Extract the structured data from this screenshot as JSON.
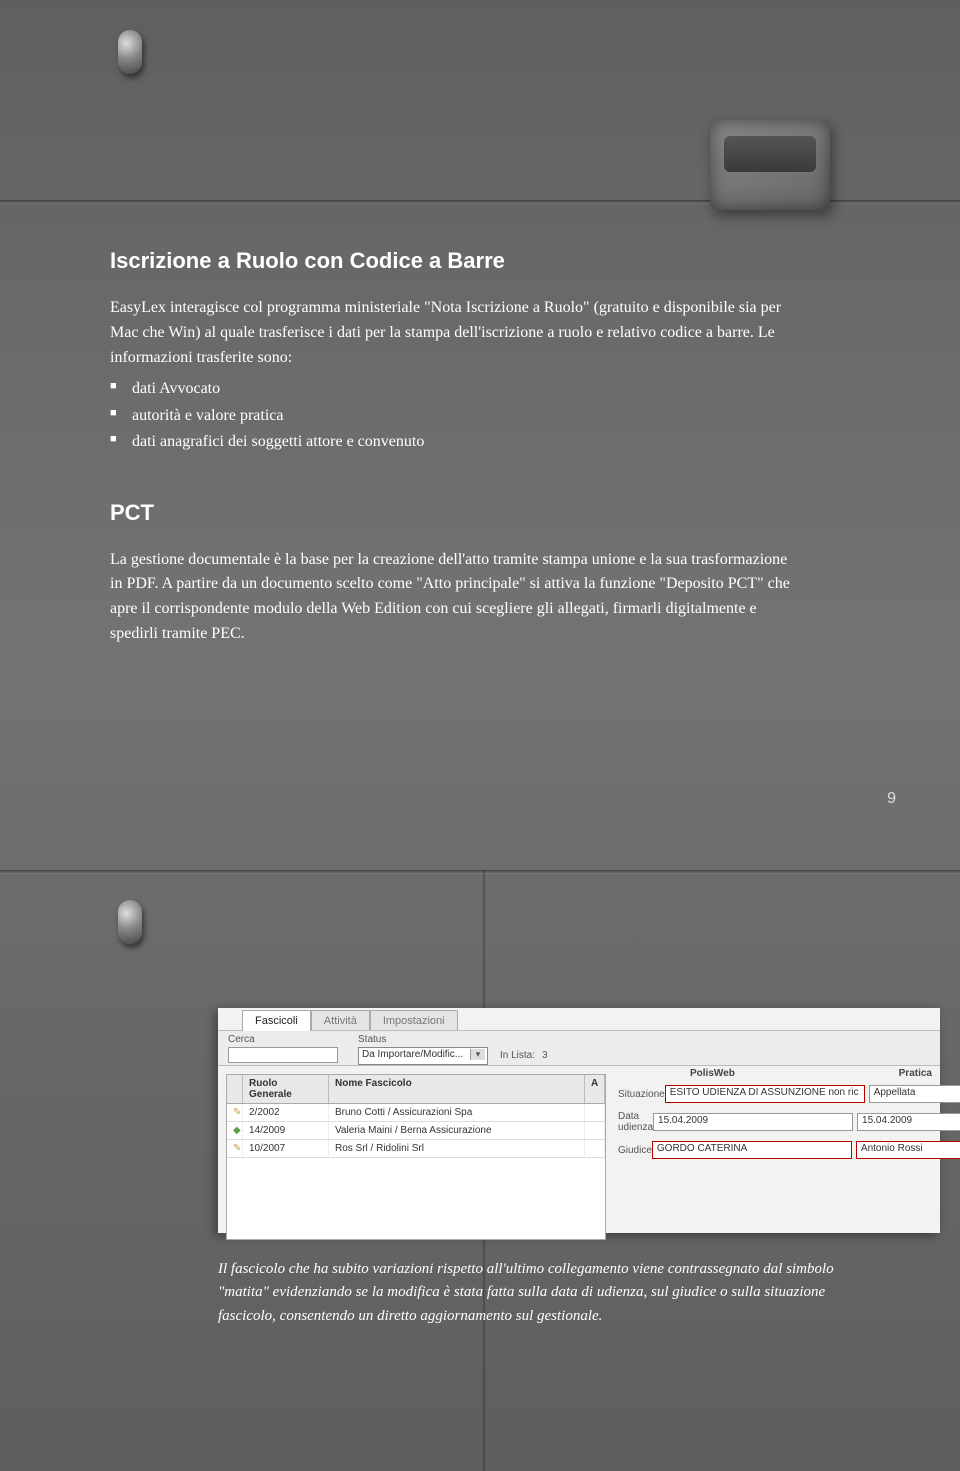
{
  "page_number": "9",
  "section1": {
    "title": "Iscrizione a Ruolo con Codice a Barre",
    "paragraph": "EasyLex interagisce col programma ministeriale \"Nota Iscrizione a Ruolo\" (gratuito e disponibile sia per Mac che Win) al quale trasferisce i dati per la stampa dell'iscrizione a ruolo e relativo codice a barre. Le informazioni trasferite sono:",
    "bullets": [
      "dati Avvocato",
      "autorità e valore pratica",
      "dati anagrafici dei soggetti attore e convenuto"
    ]
  },
  "section2": {
    "title": "PCT",
    "paragraph": "La gestione documentale è la base per la creazione dell'atto tramite stampa unione e la sua trasformazione in PDF. A partire da un documento scelto come \"Atto principale\" si attiva la funzione \"Deposito PCT\" che apre il corrispondente modulo della Web Edition con cui scegliere gli allegati, firmarli digitalmente e spedirli tramite PEC."
  },
  "screenshot": {
    "tabs": {
      "t1": "Fascicoli",
      "t2": "Attività",
      "t3": "Impostazioni"
    },
    "cerca_label": "Cerca",
    "status_label": "Status",
    "status_value": "Da Importare/Modific...",
    "inlista_label": "In Lista:",
    "inlista_value": "3",
    "list": {
      "col_rg": "Ruolo Generale",
      "col_nf": "Nome Fascicolo",
      "col_a": "A",
      "rows": [
        {
          "rg": "2/2002",
          "nf": "Bruno Cotti /  Assicurazioni Spa"
        },
        {
          "rg": "14/2009",
          "nf": "Valeria Maini /  Berna Assicurazione"
        },
        {
          "rg": "10/2007",
          "nf": "Ros Srl /  Ridolini Srl"
        }
      ]
    },
    "right": {
      "col_pw": "PolisWeb",
      "col_pr": "Pratica",
      "situazione_label": "Situazione",
      "situazione_pw": "ESITO UDIENZA DI ASSUNZIONE non ric",
      "situazione_pr": "Appellata",
      "data_label": "Data udienza",
      "data_pw": "15.04.2009",
      "data_pr": "15.04.2009",
      "giudice_label": "Giudice",
      "giudice_pw": "GORDO CATERINA",
      "giudice_pr": "Antonio Rossi"
    }
  },
  "caption": "Il fascicolo che ha subito variazioni rispetto all'ultimo collegamento viene contrassegnato dal simbolo \"matita\" evidenziando se la modifica è stata fatta sulla data di udienza, sul giudice o sulla situazione fascicolo, consentendo un diretto aggiornamento sul gestionale."
}
